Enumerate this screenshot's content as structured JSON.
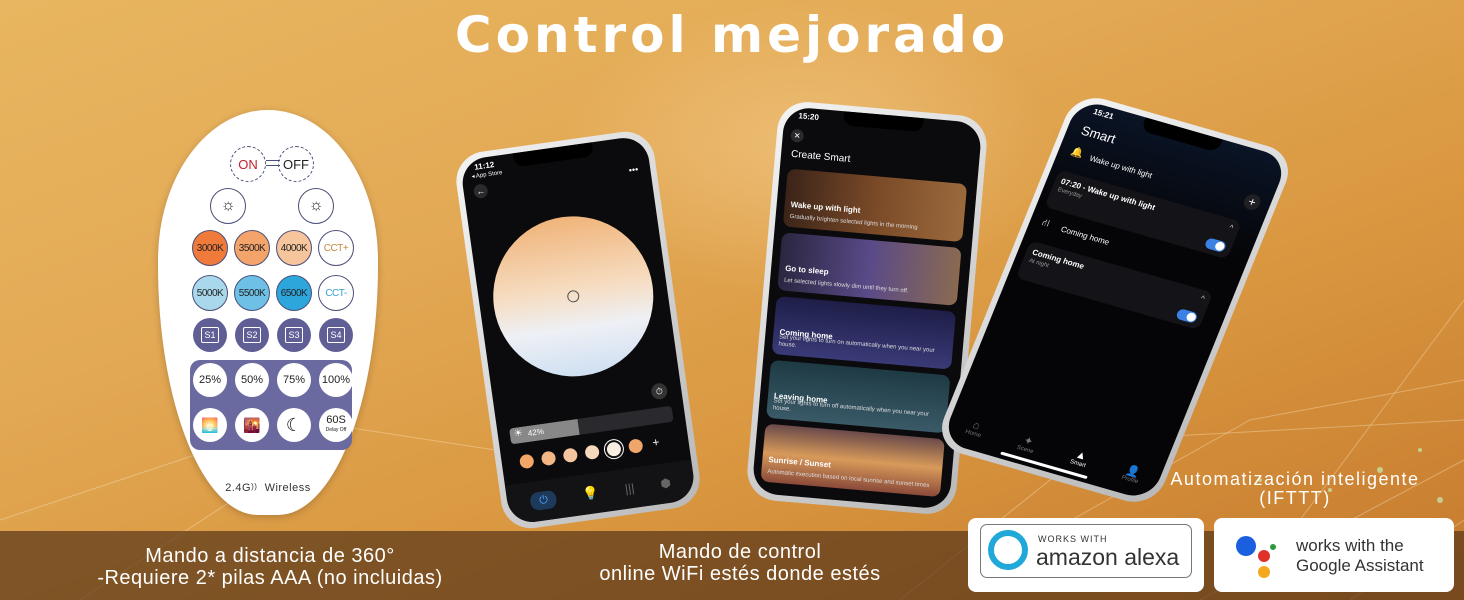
{
  "title": "Control mejorado",
  "remote": {
    "on_label": "ON",
    "off_label": "OFF",
    "brightness_up_icon": "sun-plus-icon",
    "brightness_down_icon": "sun-minus-icon",
    "warm_buttons": [
      {
        "label": "3000K",
        "color": "#f07a3a"
      },
      {
        "label": "3500K",
        "color": "#f4a36a"
      },
      {
        "label": "4000K",
        "color": "#f7c59c"
      },
      {
        "label": "CCT+",
        "color": "#ffffff",
        "text_color": "#c7893f"
      }
    ],
    "cool_buttons": [
      {
        "label": "5000K",
        "color": "#a9d8ec"
      },
      {
        "label": "5500K",
        "color": "#6ec0e6"
      },
      {
        "label": "6500K",
        "color": "#2da6dc"
      },
      {
        "label": "CCT-",
        "color": "#ffffff",
        "text_color": "#3aa0d0"
      }
    ],
    "scene_buttons": [
      "S1",
      "S2",
      "S3",
      "S4"
    ],
    "level_buttons": [
      "25%",
      "50%",
      "75%",
      "100%"
    ],
    "mode_buttons": [
      {
        "icon": "sunrise-icon"
      },
      {
        "icon": "sunset-icon"
      },
      {
        "icon": "moon-icon"
      },
      {
        "label": "60S",
        "sub": "Delay Off"
      }
    ],
    "footer": "2.4G",
    "footer_suffix": "Wireless"
  },
  "phone1": {
    "time": "11:12",
    "back_app": "◂ App Store",
    "brightness": "42%",
    "brightness_fraction": 0.42,
    "swatches": [
      "#f2a668",
      "#f3b684",
      "#f4c69e",
      "#f6d9bc",
      "#f9eee2",
      "#f0a56a"
    ],
    "selected_swatch": 4,
    "add_label": "+",
    "nav": [
      "power-icon",
      "bulb-icon",
      "music-icon",
      "hex-icon"
    ]
  },
  "phone2": {
    "time": "15:20",
    "heading": "Create Smart",
    "cards": [
      {
        "title": "Wake up with light",
        "desc": "Gradually brighten selected lights in the morning",
        "bg": "linear-gradient(90deg,#3b2418,#7a4a28,#9b6a3c)"
      },
      {
        "title": "Go to sleep",
        "desc": "Let selected lights slowly dim until they turn off.",
        "bg": "linear-gradient(90deg,#2a2640,#5a4a88,#8a6a50)"
      },
      {
        "title": "Coming home",
        "desc": "Set your lights to turn on automatically when you near your house.",
        "bg": "linear-gradient(180deg,#1e1e48,#3a3a78)"
      },
      {
        "title": "Leaving home",
        "desc": "Set your lights to turn off automatically when you near your house.",
        "bg": "linear-gradient(180deg,#1e3a44,#3a5a68)"
      },
      {
        "title": "Sunrise / Sunset",
        "desc": "Automatic execution based on local sunrise and sunset times",
        "bg": "linear-gradient(180deg,#6a4a4a,#d89a5a,#8a4a3a)"
      }
    ]
  },
  "phone3": {
    "time": "15:21",
    "heading": "Smart",
    "items": [
      {
        "label": "Wake up with light",
        "icon": "bell-icon"
      },
      {
        "label": "07:20 - Wake up with light",
        "sub": "Everyday",
        "toggle": true
      },
      {
        "label": "Coming home",
        "icon": "road-icon"
      },
      {
        "label": "Coming home",
        "sub": "At night",
        "toggle": true
      }
    ],
    "tabs": [
      "Home",
      "Scene",
      "Smart",
      "Profile"
    ],
    "active_tab": "Smart"
  },
  "captions": {
    "remote_line1": "Mando a distancia de 360°",
    "remote_line2": "-Requiere 2* pilas AAA (no incluidas)",
    "app_line1": "Mando de control",
    "app_line2": "online WiFi estés donde estés",
    "auto_line1": "Automatización inteligente",
    "auto_line2": "(IFTTT)"
  },
  "badges": {
    "alexa_small": "WORKS WITH",
    "alexa_big": "amazon alexa",
    "google_line1": "works with the",
    "google_line2": "Google Assistant",
    "alexa_color": "#1fa8d8",
    "google_colors": [
      "#1a5fe0",
      "#e0302a",
      "#f4a81e",
      "#2a9a3a"
    ]
  }
}
